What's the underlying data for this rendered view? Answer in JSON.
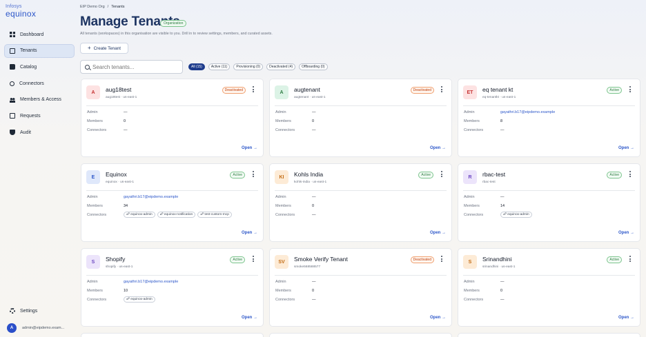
{
  "brand": {
    "top": "Infosys",
    "main": "equinox"
  },
  "sidebar": {
    "items": [
      {
        "label": "Dashboard",
        "icon": "dashboard-icon"
      },
      {
        "label": "Tenants",
        "icon": "tenants-icon"
      },
      {
        "label": "Catalog",
        "icon": "catalog-icon"
      },
      {
        "label": "Connectors",
        "icon": "connectors-icon"
      },
      {
        "label": "Members & Access",
        "icon": "members-icon"
      },
      {
        "label": "Requests",
        "icon": "requests-icon"
      },
      {
        "label": "Audit",
        "icon": "audit-icon"
      }
    ],
    "active": "Tenants",
    "settings_label": "Settings",
    "user": {
      "initial": "A",
      "email": "admin@eipdemo.exam..."
    }
  },
  "header": {
    "breadcrumb": [
      "EIP Demo Org",
      "Tenants"
    ],
    "title": "Manage Tenants",
    "badge": "Organization",
    "subtitle": "All tenants (workspaces) in this organisation are visible to you. Drill in to review settings, members, and curated assets.",
    "create_label": "Create Tenant"
  },
  "search": {
    "placeholder": "Search tenants..."
  },
  "filters": [
    "All (15)",
    "Active (11)",
    "Provisioning (0)",
    "Deactivated (4)",
    "Offboarding (0)"
  ],
  "row_labels": {
    "admin": "Admin",
    "members": "Members",
    "connectors": "Connectors"
  },
  "open_label": "Open →",
  "tenants": [
    {
      "initials": "A",
      "name": "aug18test",
      "sub": "aug18test · us-east-1",
      "status": "Deactivated",
      "admin": "—",
      "members": "0",
      "connectors": "—",
      "avatar_bg": "#fde2e2",
      "avatar_fg": "#c53030"
    },
    {
      "initials": "A",
      "name": "augtenant",
      "sub": "augtenant · us-east-1",
      "status": "Deactivated",
      "admin": "—",
      "members": "0",
      "connectors": "—",
      "avatar_bg": "#dcf3e6",
      "avatar_fg": "#2f7d43"
    },
    {
      "initials": "ET",
      "name": "eq tenant kt",
      "sub": "eq-tenantkt · us-east-1",
      "status": "Active",
      "admin": "gayathri.b17@eipdemo.example",
      "members": "8",
      "connectors": "—",
      "avatar_bg": "#fde2e2",
      "avatar_fg": "#c53030"
    },
    {
      "initials": "E",
      "name": "Equinox",
      "sub": "equinox · us-east-1",
      "status": "Active",
      "admin": "gayathri.b17@eipdemo.example",
      "members": "34",
      "connectors": [
        "equinox-admin",
        "equinox-notification",
        "test-custom-mcp"
      ],
      "avatar_bg": "#dfe8fb",
      "avatar_fg": "#2b56c9"
    },
    {
      "initials": "KI",
      "name": "Kohls India",
      "sub": "kohls-india · us-east-1",
      "status": "Active",
      "admin": "—",
      "members": "0",
      "connectors": "—",
      "avatar_bg": "#fdebd6",
      "avatar_fg": "#c26a12"
    },
    {
      "initials": "R",
      "name": "rbac-test",
      "sub": "rbac-test",
      "status": "Active",
      "admin": "—",
      "members": "14",
      "connectors": [
        "equinox-admin"
      ],
      "avatar_bg": "#ece4fb",
      "avatar_fg": "#6b46c1"
    },
    {
      "initials": "S",
      "name": "Shopify",
      "sub": "shopify · us-east-1",
      "status": "Active",
      "admin": "gayathri.b17@eipdemo.example",
      "members": "10",
      "connectors": [
        "equinox-admin"
      ],
      "avatar_bg": "#ece4fb",
      "avatar_fg": "#6b46c1"
    },
    {
      "initials": "SV",
      "name": "Smoke Verify Tenant",
      "sub": "smoke568588577",
      "status": "Deactivated",
      "admin": "—",
      "members": "0",
      "connectors": "—",
      "avatar_bg": "#fdebd6",
      "avatar_fg": "#c26a12"
    },
    {
      "initials": "S",
      "name": "Srinandhini",
      "sub": "srinandhini · us-east-1",
      "status": "Active",
      "admin": "—",
      "members": "0",
      "connectors": "—",
      "avatar_bg": "#fdebd6",
      "avatar_fg": "#c26a12"
    }
  ]
}
